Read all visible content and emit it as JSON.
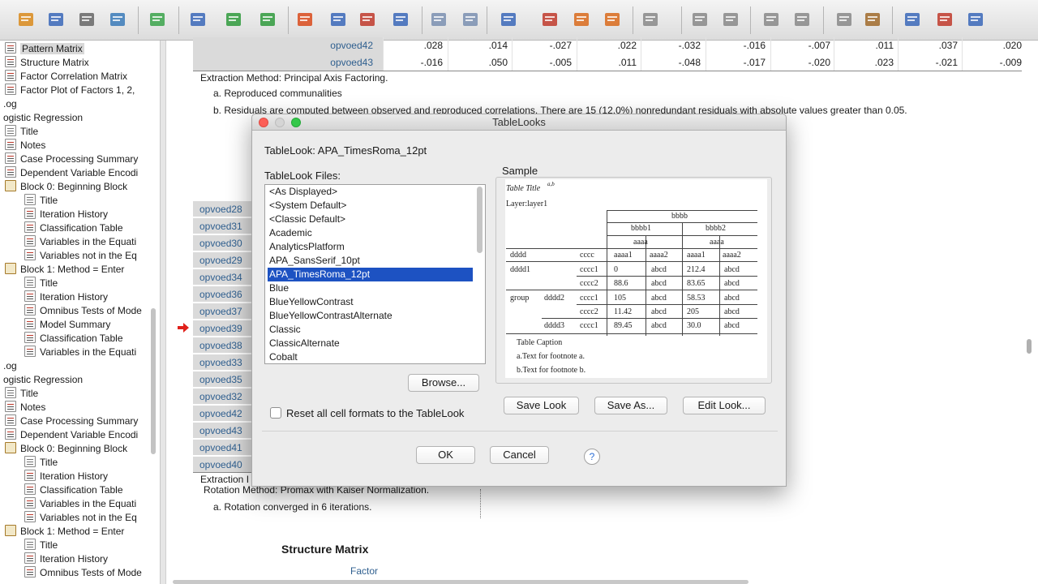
{
  "toolbar": {
    "buttons": [
      "open-icon",
      "save-icon",
      "print-icon",
      "print-preview-icon",
      "export-icon",
      "recall-dialog-icon",
      "undo-icon",
      "redo-icon",
      "goto-case-icon",
      "goto-variable-icon",
      "goto-data-icon",
      "variables-icon",
      "create-graph-icon",
      "split-file-icon",
      "weight-cases-icon",
      "select-cases-icon",
      "insert-output-icon",
      "insert-heading-icon",
      "insert-title-icon",
      "insert-text-icon",
      "script-icon",
      "back-icon",
      "forward-icon",
      "expand-icon",
      "collapse-icon",
      "show-icon",
      "hide-icon",
      "designate-window-icon",
      "new-window-icon",
      "sync-icon"
    ]
  },
  "nav": {
    "items": [
      {
        "label": "Pattern Matrix",
        "icon": "table",
        "indent": 1,
        "selected": true
      },
      {
        "label": "Structure Matrix",
        "icon": "table",
        "indent": 1
      },
      {
        "label": "Factor Correlation Matrix",
        "icon": "table",
        "indent": 1
      },
      {
        "label": "Factor Plot of Factors 1, 2,",
        "icon": "table",
        "indent": 1
      },
      {
        "label": ".og",
        "icon": "",
        "indent": 0
      },
      {
        "label": "ogistic Regression",
        "icon": "",
        "indent": 0
      },
      {
        "label": "Title",
        "icon": "text",
        "indent": 1
      },
      {
        "label": "Notes",
        "icon": "table",
        "indent": 1
      },
      {
        "label": "Case Processing Summary",
        "icon": "table",
        "indent": 1
      },
      {
        "label": "Dependent Variable Encodi",
        "icon": "table",
        "indent": 1
      },
      {
        "label": "Block 0: Beginning Block",
        "icon": "book",
        "indent": 1
      },
      {
        "label": "Title",
        "icon": "text",
        "indent": 2
      },
      {
        "label": "Iteration History",
        "icon": "table",
        "indent": 2
      },
      {
        "label": "Classification Table",
        "icon": "table",
        "indent": 2
      },
      {
        "label": "Variables in the Equati",
        "icon": "table",
        "indent": 2
      },
      {
        "label": "Variables not in the Eq",
        "icon": "table",
        "indent": 2
      },
      {
        "label": "Block 1: Method = Enter",
        "icon": "book",
        "indent": 1
      },
      {
        "label": "Title",
        "icon": "text",
        "indent": 2
      },
      {
        "label": "Iteration History",
        "icon": "table",
        "indent": 2
      },
      {
        "label": "Omnibus Tests of Mode",
        "icon": "table",
        "indent": 2
      },
      {
        "label": "Model Summary",
        "icon": "table",
        "indent": 2
      },
      {
        "label": "Classification Table",
        "icon": "table",
        "indent": 2
      },
      {
        "label": "Variables in the Equati",
        "icon": "table",
        "indent": 2
      },
      {
        "label": ".og",
        "icon": "",
        "indent": 0
      },
      {
        "label": "ogistic Regression",
        "icon": "",
        "indent": 0
      },
      {
        "label": "Title",
        "icon": "text",
        "indent": 1
      },
      {
        "label": "Notes",
        "icon": "table",
        "indent": 1
      },
      {
        "label": "Case Processing Summary",
        "icon": "table",
        "indent": 1
      },
      {
        "label": "Dependent Variable Encodi",
        "icon": "table",
        "indent": 1
      },
      {
        "label": "Block 0: Beginning Block",
        "icon": "book",
        "indent": 1
      },
      {
        "label": "Title",
        "icon": "text",
        "indent": 2
      },
      {
        "label": "Iteration History",
        "icon": "table",
        "indent": 2
      },
      {
        "label": "Classification Table",
        "icon": "table",
        "indent": 2
      },
      {
        "label": "Variables in the Equati",
        "icon": "table",
        "indent": 2
      },
      {
        "label": "Variables not in the Eq",
        "icon": "table",
        "indent": 2
      },
      {
        "label": "Block 1: Method = Enter",
        "icon": "book",
        "indent": 1
      },
      {
        "label": "Title",
        "icon": "text",
        "indent": 2
      },
      {
        "label": "Iteration History",
        "icon": "table",
        "indent": 2
      },
      {
        "label": "Omnibus Tests of Mode",
        "icon": "table",
        "indent": 2
      }
    ]
  },
  "viewer": {
    "top_rows": [
      {
        "label": "opvoed42",
        "values": [
          ".028",
          ".014",
          "-.027",
          ".022",
          "-.032",
          "-.016",
          "-.007",
          ".011",
          ".037",
          ".020"
        ]
      },
      {
        "label": "opvoed43",
        "values": [
          "-.016",
          ".050",
          "-.005",
          ".011",
          "-.048",
          "-.017",
          "-.020",
          ".023",
          "-.021",
          "-.009"
        ]
      }
    ],
    "extraction_note": "Extraction Method: Principal Axis Factoring.",
    "footnote_a": "a. Reproduced communalities",
    "footnote_b": "b. Residuals are computed between observed and reproduced correlations. There are 15 (12.0%) nonredundant residuals with absolute values greater than 0.05.",
    "row_labels": [
      "opvoed28",
      "opvoed31",
      "opvoed30",
      "opvoed29",
      "opvoed34",
      "opvoed36",
      "opvoed37",
      "opvoed39",
      "opvoed38",
      "opvoed33",
      "opvoed35",
      "opvoed32",
      "opvoed42",
      "opvoed43",
      "opvoed41",
      "opvoed40"
    ],
    "extraction_short": "Extraction I",
    "rotation_note": "Rotation Method: Promax with Kaiser Normalization.",
    "rotation_footnote": "a. Rotation converged in 6 iterations.",
    "structure_title": "Structure Matrix",
    "factor_label": "Factor"
  },
  "dialog": {
    "title": "TableLooks",
    "current_look": "TableLook: APA_TimesRoma_12pt",
    "files_label": "TableLook Files:",
    "files": [
      "<As Displayed>",
      "<System Default>",
      "<Classic Default>",
      "Academic",
      "AnalyticsPlatform",
      "APA_SansSerif_10pt",
      "APA_TimesRoma_12pt",
      "Blue",
      "BlueYellowContrast",
      "BlueYellowContrastAlternate",
      "Classic",
      "ClassicAlternate",
      "Cobalt"
    ],
    "selected_index": 6,
    "browse_label": "Browse...",
    "reset_label": "Reset all cell formats to the TableLook",
    "reset_checked": false,
    "sample_label": "Sample",
    "save_look_label": "Save Look",
    "save_as_label": "Save As...",
    "edit_look_label": "Edit Look...",
    "ok_label": "OK",
    "cancel_label": "Cancel",
    "help_label": "?",
    "sample": {
      "table_title": "Table Title",
      "title_sup": "a,b",
      "layer": "Layer:layer1",
      "bbbb": "bbbb",
      "bbbb1": "bbbb1",
      "bbbb2": "bbbb2",
      "aaaa": "aaaa",
      "dddd": "dddd",
      "cccc": "cccc",
      "aaaa1": "aaaa1",
      "aaaa2": "aaaa2",
      "rows": [
        {
          "r1": "dddd1",
          "r2": "",
          "r3": "cccc1",
          "v1": "0",
          "v2": "abcd",
          "v3": "212.4",
          "v4": "abcd"
        },
        {
          "r1": "",
          "r2": "",
          "r3": "cccc2",
          "v1": "88.6",
          "v2": "abcd",
          "v3": "83.65",
          "v4": "abcd"
        },
        {
          "r1": "group",
          "r2": "dddd2",
          "r3": "cccc1",
          "v1": "105",
          "v2": "abcd",
          "v3": "58.53",
          "v4": "abcd"
        },
        {
          "r1": "",
          "r2": "",
          "r3": "cccc2",
          "v1": "11.42",
          "v2": "abcd",
          "v3": "205",
          "v4": "abcd"
        },
        {
          "r1": "",
          "r2": "dddd3",
          "r3": "cccc1",
          "v1": "89.45",
          "v2": "abcd",
          "v3": "30.0",
          "v4": "abcd"
        }
      ],
      "caption": "Table Caption",
      "foot_a": "a.Text for footnote a.",
      "foot_b": "b.Text for footnote b."
    }
  }
}
